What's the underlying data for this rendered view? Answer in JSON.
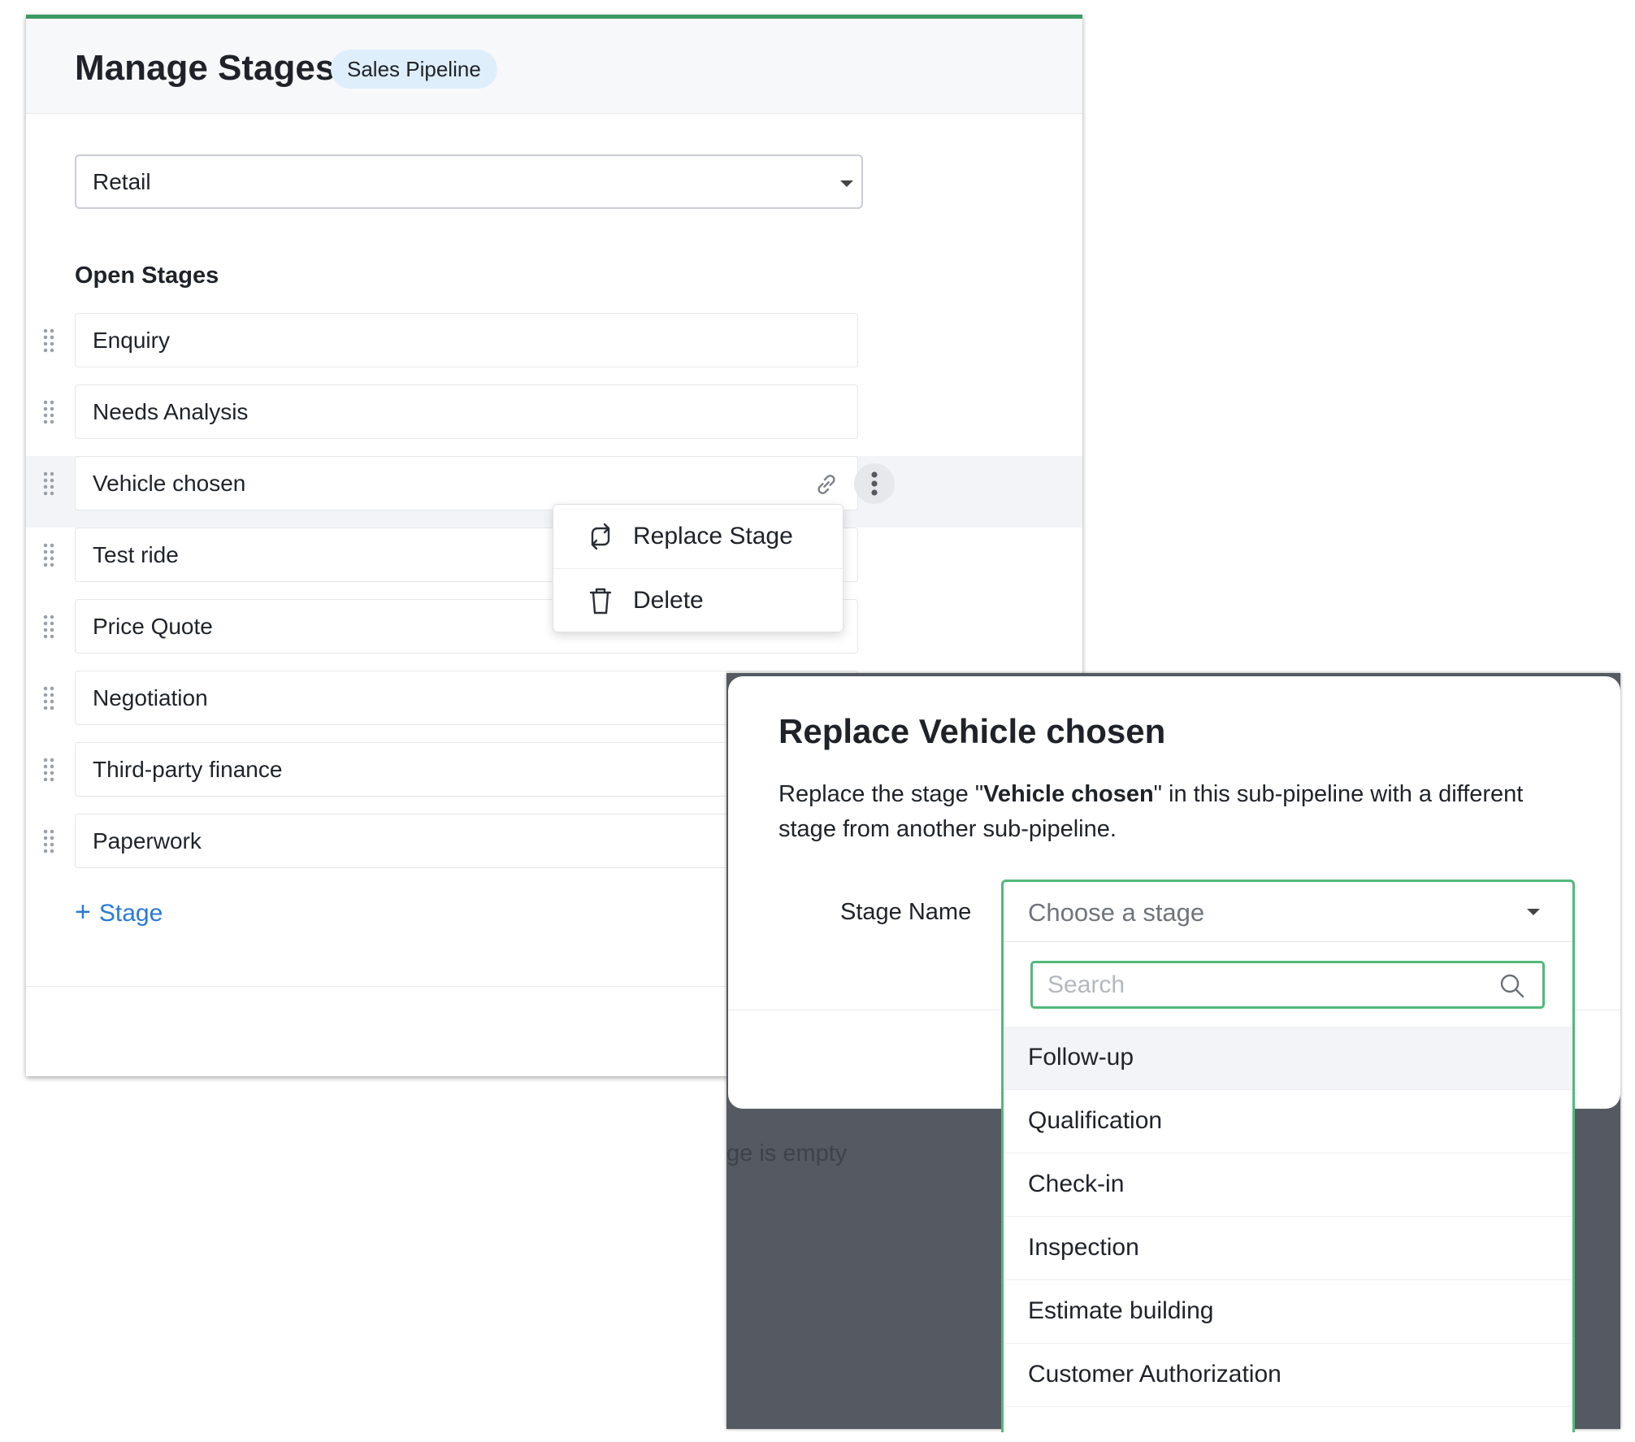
{
  "manage_stages": {
    "title": "Manage Stages",
    "pipeline_badge": "Sales Pipeline",
    "subpipeline_select": {
      "value": "Retail"
    },
    "open_stages_heading": "Open Stages",
    "stages": [
      {
        "label": "Enquiry"
      },
      {
        "label": "Needs Analysis"
      },
      {
        "label": "Vehicle chosen",
        "highlighted": true
      },
      {
        "label": "Test ride"
      },
      {
        "label": "Price Quote"
      },
      {
        "label": "Negotiation"
      },
      {
        "label": "Third-party finance"
      },
      {
        "label": "Paperwork"
      }
    ],
    "add_stage_plus": "+",
    "add_stage_label": "Stage"
  },
  "context_menu": {
    "items": [
      {
        "label": "Replace Stage",
        "icon": "replace-icon"
      },
      {
        "label": "Delete",
        "icon": "trash-icon"
      }
    ]
  },
  "backdrop": {
    "empty_text": "ge is empty"
  },
  "replace_modal": {
    "title": "Replace Vehicle chosen",
    "description_before": "Replace the stage \"",
    "description_stage": "Vehicle chosen",
    "description_after": "\" in this sub-pipeline with a different stage from another sub-pipeline.",
    "stage_name_label": "Stage Name",
    "dropdown": {
      "placeholder": "Choose a stage",
      "search_placeholder": "Search",
      "options": [
        "Follow-up",
        "Qualification",
        "Check-in",
        "Inspection",
        "Estimate building",
        "Customer Authorization"
      ],
      "hovered_index": 0
    }
  },
  "colors": {
    "accent_green": "#52b97a",
    "header_green": "#3c9a64",
    "link_blue": "#2a7ad8",
    "badge_bg": "#dfeefb",
    "backdrop": "#555961"
  }
}
